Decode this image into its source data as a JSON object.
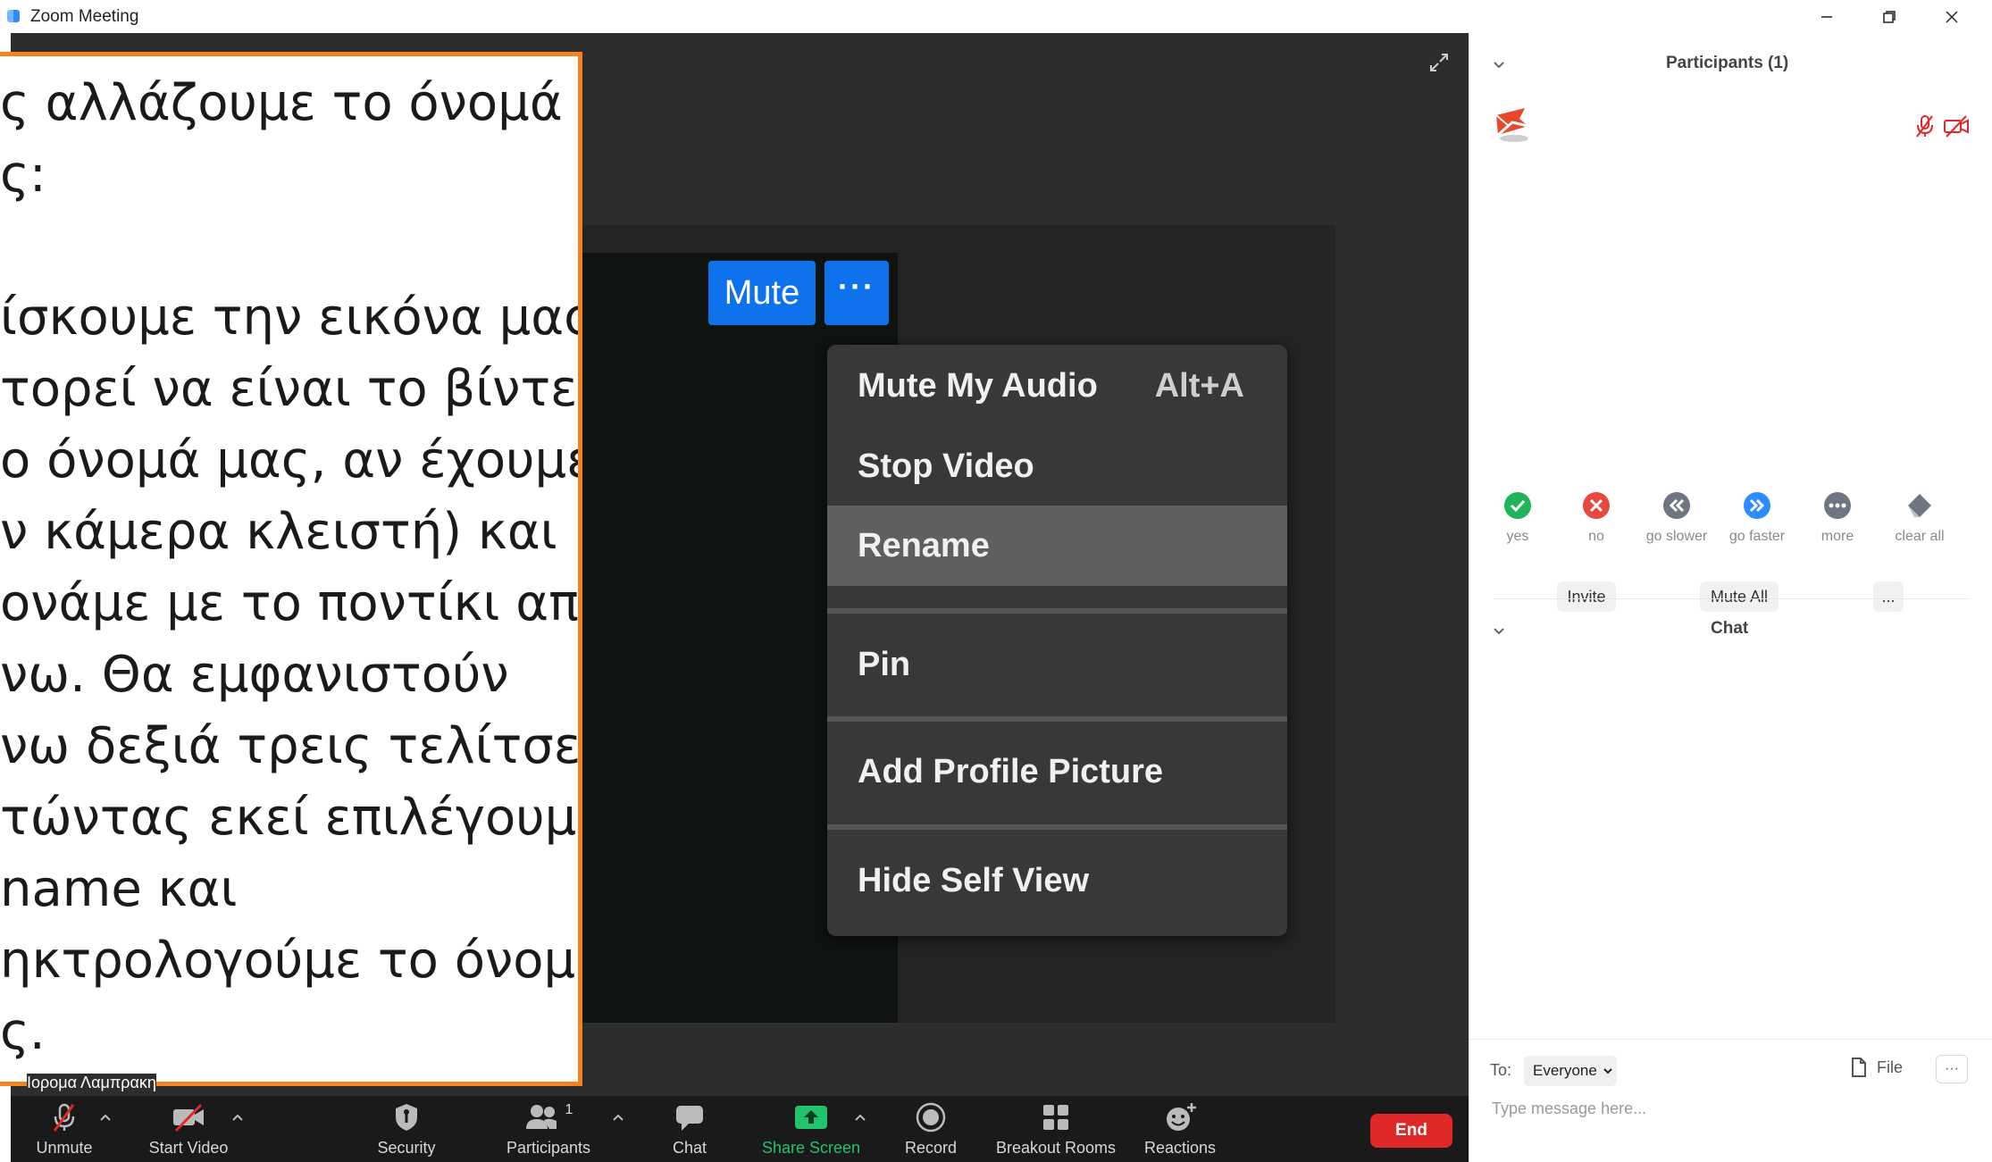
{
  "window": {
    "title": "Zoom Meeting",
    "accent": "#0e72ed"
  },
  "video": {
    "mute_label": "Mute",
    "more_label": "···",
    "name_tag": "Ιορομα Λαμπρακη"
  },
  "context_menu": {
    "items": [
      {
        "label": "Mute My Audio",
        "shortcut": "Alt+A"
      },
      {
        "label": "Stop Video"
      },
      {
        "label": "Rename"
      },
      {
        "label": "Pin"
      },
      {
        "label": "Add Profile Picture"
      },
      {
        "label": "Hide Self View"
      }
    ]
  },
  "slide": {
    "lines": [
      "ς αλλάζουμε το όνομά",
      "ς:",
      "",
      "ίσκουμε την εικόνα μας",
      "τορεί να είναι το βίντεο",
      "ο όνομά μας, αν έχουμε",
      "ν κάμερα κλειστή) και",
      "ονάμε με το ποντίκι από",
      "νω. Θα εμφανιστούν",
      "νω δεξιά τρεις τελίτσες.",
      "τώντας εκεί επιλέγουμε",
      "name και",
      "ηκτρολογούμε το όνομά",
      "ς."
    ]
  },
  "toolbar": {
    "unmute": "Unmute",
    "start_video": "Start Video",
    "security": "Security",
    "participants": "Participants",
    "participants_count": "1",
    "chat": "Chat",
    "share_screen": "Share Screen",
    "record": "Record",
    "breakout_rooms": "Breakout Rooms",
    "reactions": "Reactions",
    "end": "End",
    "share_color": "#21c36c",
    "end_color": "#e02828"
  },
  "participants_panel": {
    "title": "Participants (1)",
    "reactions": [
      {
        "label": "yes",
        "icon": "check-icon",
        "color": "#1fb35a"
      },
      {
        "label": "no",
        "icon": "x-icon",
        "color": "#e8473f"
      },
      {
        "label": "go slower",
        "icon": "rewind-icon",
        "color": "#6e7683"
      },
      {
        "label": "go faster",
        "icon": "fast-forward-icon",
        "color": "#2d8cff"
      },
      {
        "label": "more",
        "icon": "ellipsis-icon",
        "color": "#6e7683"
      },
      {
        "label": "clear all",
        "icon": "eraser-icon",
        "color": "#6e7683"
      }
    ],
    "invite": "Invite",
    "mute_all": "Mute All",
    "more": "..."
  },
  "chat_panel": {
    "title": "Chat",
    "to_label": "To:",
    "recipient": "Everyone",
    "file_label": "File",
    "more": "···",
    "placeholder": "Type message here..."
  }
}
